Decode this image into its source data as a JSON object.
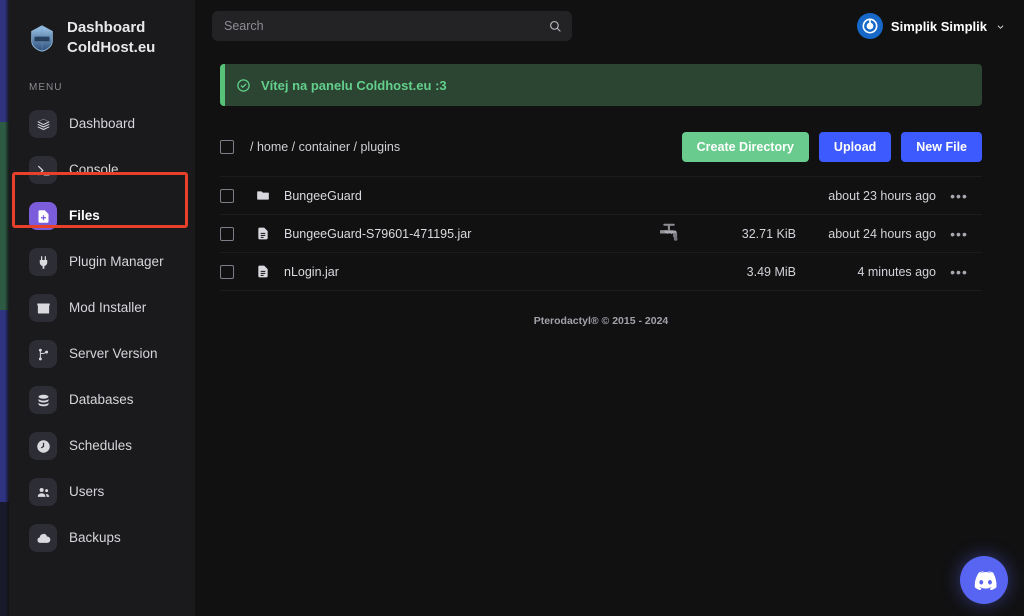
{
  "edge": {
    "colors": [
      "#2f3380",
      "#2d5a43",
      "#2e3382",
      "#191b2c"
    ]
  },
  "sidebar": {
    "brand": {
      "line1": "Dashboard",
      "line2": "ColdHost.eu",
      "logo_icon": "coldhost-logo-icon"
    },
    "section_label": "MENU",
    "items": [
      {
        "label": "Dashboard",
        "icon": "layers-icon",
        "active": false
      },
      {
        "label": "Console",
        "icon": "terminal-icon",
        "active": false
      },
      {
        "label": "Files",
        "icon": "file-plus-icon",
        "active": true
      },
      {
        "label": "Plugin Manager",
        "icon": "plug-icon",
        "active": false
      },
      {
        "label": "Mod Installer",
        "icon": "box-icon",
        "active": false
      },
      {
        "label": "Server Version",
        "icon": "git-branch-icon",
        "active": false
      },
      {
        "label": "Databases",
        "icon": "database-icon",
        "active": false
      },
      {
        "label": "Schedules",
        "icon": "clock-icon",
        "active": false
      },
      {
        "label": "Users",
        "icon": "users-icon",
        "active": false
      },
      {
        "label": "Backups",
        "icon": "cloud-icon",
        "active": false
      }
    ],
    "annotation": {
      "target": "Console",
      "color": "#e8402a"
    }
  },
  "topbar": {
    "search": {
      "value": "",
      "placeholder": "Search",
      "icon": "search-icon"
    },
    "user": {
      "name": "Simplik Simplik",
      "avatar_icon": "power-avatar-icon",
      "chevron_icon": "chevron-down-icon",
      "avatar_color": "#1669c8"
    }
  },
  "banner": {
    "text": "Vítej na panelu Coldhost.eu :3",
    "icon": "check-circle-icon",
    "accent_color": "#57c278",
    "background_color": "#2c4532"
  },
  "file_manager": {
    "select_all_checkbox": false,
    "breadcrumb": "/ home / container / plugins",
    "buttons": [
      {
        "label": "Create Directory",
        "color": "#69cb8d",
        "style": "green"
      },
      {
        "label": "Upload",
        "color": "#3d5afe",
        "style": "blue"
      },
      {
        "label": "New File",
        "color": "#3d5afe",
        "style": "blue"
      }
    ],
    "rows": [
      {
        "name": "BungeeGuard",
        "icon": "folder-icon",
        "badge": "",
        "size": "",
        "modified": "about 23 hours ago",
        "menu": "•••"
      },
      {
        "name": "BungeeGuard-S79601-471195.jar",
        "icon": "file-icon",
        "badge": "spigot-logo-icon",
        "size": "32.71 KiB",
        "modified": "about 24 hours ago",
        "menu": "•••"
      },
      {
        "name": "nLogin.jar",
        "icon": "file-icon",
        "badge": "",
        "size": "3.49 MiB",
        "modified": "4 minutes ago",
        "menu": "•••"
      }
    ]
  },
  "footer": {
    "text": "Pterodactyl® © 2015 - 2024"
  },
  "discord": {
    "icon": "discord-icon",
    "color": "#5865f2"
  }
}
